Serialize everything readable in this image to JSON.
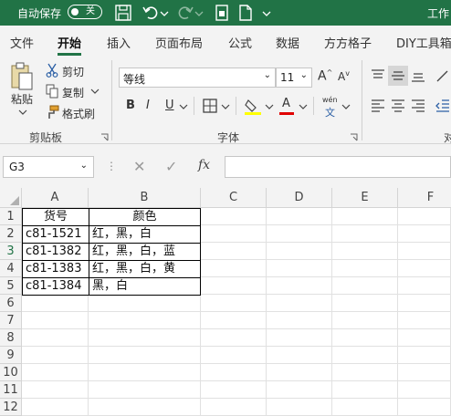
{
  "titlebar": {
    "autosave_label": "自动保存",
    "toggle_state": "关",
    "title": "工作",
    "accent_color": "#217346",
    "icons": [
      "save-icon",
      "undo-icon",
      "redo-icon",
      "touch-mode-icon",
      "new-file-icon"
    ]
  },
  "menu": {
    "items": [
      "文件",
      "开始",
      "插入",
      "页面布局",
      "公式",
      "数据",
      "方方格子",
      "DIY工具箱"
    ],
    "active": "开始"
  },
  "ribbon": {
    "clipboard": {
      "paste_label": "粘贴",
      "cut_label": "剪切",
      "copy_label": "复制",
      "format_painter_label": "格式刷",
      "group_label": "剪贴板"
    },
    "font": {
      "font_name": "等线",
      "font_size": "11",
      "bold": "B",
      "italic": "I",
      "underline": "U",
      "wen_label": "wén",
      "wen_char": "文",
      "increase_font": "A",
      "decrease_font": "A",
      "font_color_letter": "A",
      "group_label": "字体",
      "highlight_color": "#FFFF00",
      "font_color": "#E00000"
    },
    "alignment": {
      "group_label_partial": "对"
    }
  },
  "formula_bar": {
    "name_box": "G3",
    "cancel": "✕",
    "confirm": "✓",
    "fx": "fx",
    "value": ""
  },
  "sheet": {
    "columns": [
      "A",
      "B",
      "C",
      "D",
      "E",
      "F"
    ],
    "rows": [
      "1",
      "2",
      "3",
      "4",
      "5",
      "6",
      "7",
      "8",
      "9",
      "10",
      "11",
      "12"
    ],
    "selected_row": "3",
    "cells": {
      "A1": "货号",
      "B1": "颜色",
      "A2": "c81-1521",
      "B2": "红，黑，白",
      "A3": "c81-1382",
      "B3": "红，黑，白，蓝",
      "A4": "c81-1383",
      "B4": "红，黑，白，黄",
      "A5": "c81-1384",
      "B5": "黑，白"
    }
  }
}
